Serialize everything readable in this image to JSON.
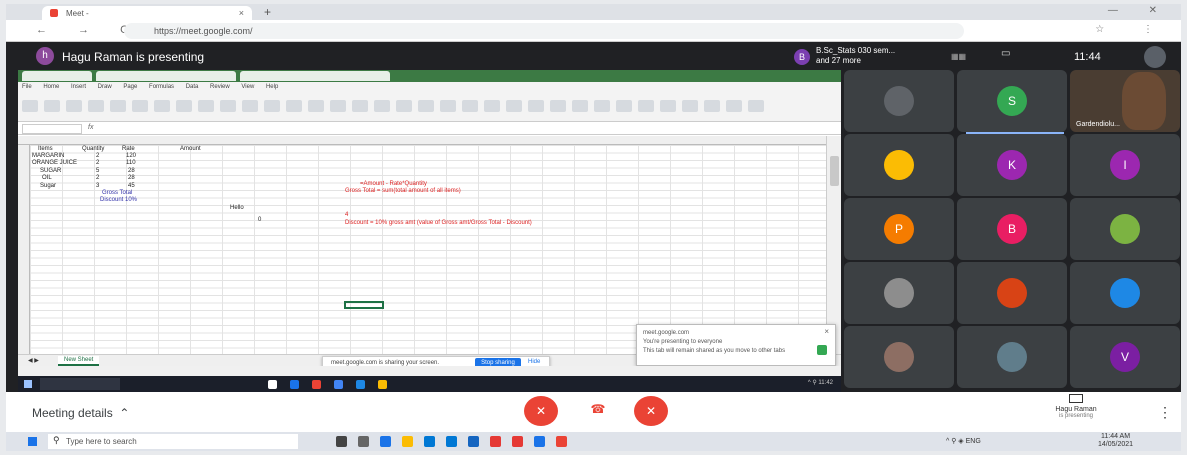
{
  "browser": {
    "tab_title": "Meet - ",
    "url": "https://meet.google.com/",
    "close_glyph": "×",
    "newtab_glyph": "+",
    "nav_glyphs": "← → C ⌂",
    "window_controls": "— ✕"
  },
  "meet_header": {
    "presenter_initial": "h",
    "presenter_text": "Hagu Raman is presenting",
    "participants_initial": "B",
    "participants_text": "B.Sc_Stats 030 sem... and 27 more",
    "clock": "11:44"
  },
  "spreadsheet": {
    "sheet_tab": "New Sheet",
    "cells": {
      "h_item": "Items",
      "h_qty": "Quantity",
      "h_rate": "Rate",
      "h_amount": "Amount",
      "r1": "MARGARIN",
      "r2": "ORANGE JUICE",
      "r3": "SUGAR",
      "r4": "OIL",
      "r5": "Sugar",
      "q1": "2",
      "q2": "2",
      "q3": "5",
      "q4": "2",
      "q5": "3",
      "rt1": "120",
      "rt2": "110",
      "rt3": "28",
      "rt4": "28",
      "rt5": "45",
      "gross": "Gross Total",
      "discount": "Discount 10%",
      "hello": "Hello",
      "n4": "4",
      "n_zero": "0",
      "note1": "=Amount - Rate*Quantity",
      "note2": "Gross Total = sum(total amount of all items)",
      "note3": "Discount = 10% gross amt (value of Gross amt/Gross Total - Discount)"
    },
    "share_banner_text": "meet.google.com is sharing your screen.",
    "stop_sharing": "Stop sharing",
    "hide": "Hide",
    "notification_title": "meet.google.com",
    "notification_line1": "You're presenting to everyone",
    "notification_line2": "This tab will remain shared as you move to other tabs"
  },
  "tiles": [
    {
      "name": "",
      "initial": "",
      "color": "#5f6368"
    },
    {
      "name": "",
      "initial": "S",
      "color": "#34a853"
    },
    {
      "name": "Gardendiolu...",
      "initial": "",
      "color": "#6b4b34"
    },
    {
      "name": "",
      "initial": "",
      "color": "#fbbc04"
    },
    {
      "name": "",
      "initial": "K",
      "color": "#9c27b0"
    },
    {
      "name": "",
      "initial": "I",
      "color": "#9c27b0"
    },
    {
      "name": "",
      "initial": "P",
      "color": "#f57c00"
    },
    {
      "name": "",
      "initial": "B",
      "color": "#e91e63"
    },
    {
      "name": "",
      "initial": "",
      "color": "#7cb342"
    },
    {
      "name": "",
      "initial": "",
      "color": "#8d8d8d"
    },
    {
      "name": "",
      "initial": "",
      "color": "#d84315"
    },
    {
      "name": "",
      "initial": "",
      "color": "#1e88e5"
    },
    {
      "name": "",
      "initial": "",
      "color": "#8d6e63"
    },
    {
      "name": "",
      "initial": "",
      "color": "#607d8b"
    },
    {
      "name": "",
      "initial": "V",
      "color": "#7b1fa2"
    }
  ],
  "bottom_bar": {
    "meeting_details": "Meeting details",
    "mic_glyph": "✕",
    "hang_glyph": "☎",
    "cam_glyph": "✕",
    "present_name": "Hagu Raman",
    "present_sub": "is presenting",
    "more_glyph": "⋮"
  },
  "taskbar": {
    "search_placeholder": "Type here to search",
    "tray": "^ ⚲ ◈ ENG",
    "time": "11:44 AM",
    "date": "14/05/2021"
  },
  "colors": {
    "accent": "#1a73e8",
    "danger": "#ea4335",
    "excel_green": "#1e7145"
  }
}
